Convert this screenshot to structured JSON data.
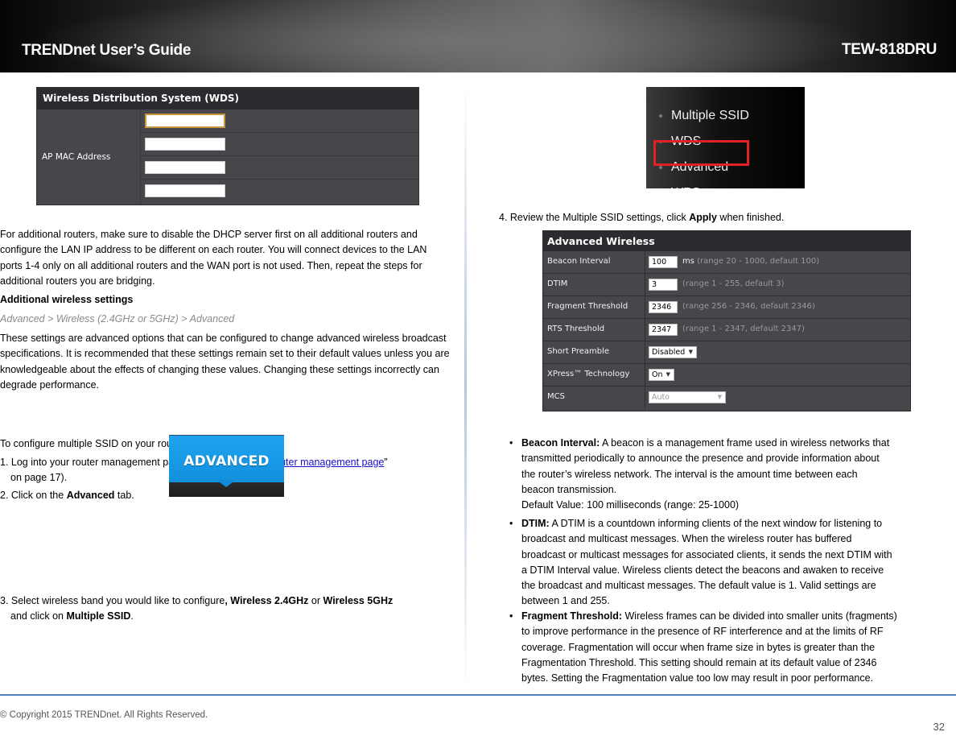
{
  "header": {
    "title_left": "TRENDnet User’s Guide",
    "title_right": "TEW-818DRU"
  },
  "left": {
    "wds_panel": {
      "title": "Wireless Distribution System (WDS)",
      "label": "AP MAC Address",
      "inputs": [
        "",
        "",
        "",
        ""
      ]
    },
    "para1": "For additional routers, make sure to disable the DHCP server first on all additional routers and configure the LAN IP address to be different on each router. You will connect devices to the LAN ports 1-4 only on all additional routers and the WAN port is not used. Then, repeat the steps for additional routers you are bridging.",
    "section_heading": "Additional wireless settings",
    "breadcrumb": "Advanced > Wireless (2.4GHz or 5GHz) > Advanced",
    "para2": "These settings are advanced options that can be configured to change advanced wireless broadcast specifications. It is recommended that these settings remain set to their default values unless you are knowledgeable about the effects of changing these values. Changing these settings incorrectly can degrade performance.",
    "intro": "To configure multiple SSID on your router:",
    "step1_prefix": "1. Log into your router management page (see “",
    "step1_link": "Access your router management page",
    "step1_suffix": "”",
    "step1_line2": "on page 17).",
    "step2_prefix": "2. Click on the ",
    "step2_bold": "Advanced",
    "step2_suffix": " tab.",
    "advanced_button": "ADVANCED",
    "step3_prefix": "3.  Select wireless band you would like to configure",
    "step3_comma": ", ",
    "step3_b1": "Wireless 2.4GHz",
    "step3_or": " or ",
    "step3_b2": "Wireless 5GHz",
    "step3_line2_prefix": "and click on ",
    "step3_line2_bold": "Multiple SSID",
    "step3_line2_suffix": "."
  },
  "right": {
    "menu": {
      "items": [
        "Multiple SSID",
        "WDS",
        "Advanced",
        "WPS"
      ],
      "highlighted": "Advanced",
      "highlight_color": "#e32026"
    },
    "step4_prefix": "4. Review the Multiple SSID settings, click ",
    "step4_bold": "Apply",
    "step4_suffix": " when finished.",
    "aw_panel": {
      "title": "Advanced Wireless",
      "rows": [
        {
          "label": "Beacon Interval",
          "value": "100",
          "unit": "ms",
          "hint": "(range 20 - 1000, default 100)"
        },
        {
          "label": "DTIM",
          "value": "3",
          "hint": "(range 1 - 255, default 3)"
        },
        {
          "label": "Fragment Threshold",
          "value": "2346",
          "hint": "(range 256 - 2346, default 2346)"
        },
        {
          "label": "RTS Threshold",
          "value": "2347",
          "hint": "(range 1 - 2347, default 2347)"
        },
        {
          "label": "Short Preamble",
          "select": "Disabled"
        },
        {
          "label": "XPress™ Technology",
          "select": "On"
        },
        {
          "label": "MCS",
          "select": "Auto"
        }
      ]
    },
    "bullets": [
      {
        "term": "Beacon Interval:",
        "lines": [
          " A beacon is a management frame used in wireless networks that",
          "transmitted periodically to announce the presence and provide information about",
          "the router’s wireless network. The interval is the amount time between each",
          "beacon transmission.",
          "Default Value: 100 milliseconds (range: 25-1000)"
        ]
      },
      {
        "term": "DTIM:",
        "lines": [
          " A DTIM is a countdown informing clients of the next window for listening to",
          "broadcast and multicast messages. When the wireless router has buffered",
          "broadcast or multicast messages for associated clients, it sends the next DTIM with",
          "a DTIM Interval value. Wireless clients detect the beacons and awaken to receive",
          "the broadcast and multicast messages. The default value is 1. Valid settings are",
          "between 1 and 255."
        ]
      },
      {
        "term": "Fragment Threshold:",
        "lines": [
          " Wireless frames can be divided into smaller units (fragments)",
          "to improve performance in the presence of RF interference and at the limits of RF",
          "coverage. Fragmentation will occur when frame size in bytes is greater than the",
          "Fragmentation Threshold. This setting should remain at its default value of 2346",
          "bytes. Setting the Fragmentation value too low may result in poor performance."
        ]
      }
    ]
  },
  "footer": {
    "copyright": "© Copyright 2015 TRENDnet. All Rights Reserved.",
    "page_number": "32",
    "rule_color": "#4f81bd"
  }
}
